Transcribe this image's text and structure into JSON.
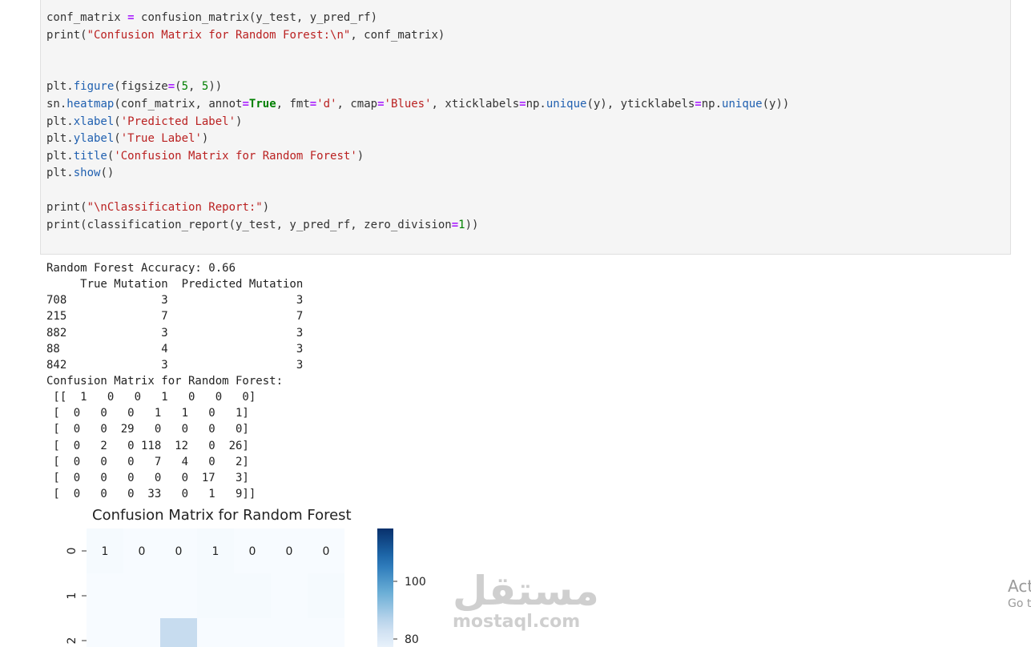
{
  "code": {
    "line1": [
      "conf_matrix ",
      "=",
      " confusion_matrix(y_test, y_pred_rf)"
    ],
    "line2": [
      "print(",
      "\"Confusion Matrix for Random Forest:\\n\"",
      ", conf_matrix)"
    ],
    "line3": [
      "plt.",
      "figure",
      "(figsize",
      "=",
      "(",
      "5",
      ", ",
      "5",
      "))"
    ],
    "line4": [
      "sn.",
      "heatmap",
      "(conf_matrix, annot",
      "=",
      "True",
      ", fmt",
      "=",
      "'d'",
      ", cmap",
      "=",
      "'Blues'",
      ", xticklabels",
      "=",
      "np.",
      "unique",
      "(y), yticklabels",
      "=",
      "np.",
      "unique",
      "(y))"
    ],
    "line5": [
      "plt.",
      "xlabel",
      "(",
      "'Predicted Label'",
      ")"
    ],
    "line6": [
      "plt.",
      "ylabel",
      "(",
      "'True Label'",
      ")"
    ],
    "line7": [
      "plt.",
      "title",
      "(",
      "'Confusion Matrix for Random Forest'",
      ")"
    ],
    "line8": [
      "plt.",
      "show",
      "()"
    ],
    "line9": [
      "print(",
      "\"\\nClassification Report:\"",
      ")"
    ],
    "line10": [
      "print(classification_report(y_test, y_pred_rf, zero_division",
      "=",
      "1",
      "))"
    ]
  },
  "output": {
    "accuracy": "Random Forest Accuracy: 0.66",
    "table_header": "     True Mutation  Predicted Mutation",
    "table_rows": [
      "708              3                   3",
      "215              7                   7",
      "882              3                   3",
      "88               4                   3",
      "842              3                   3"
    ],
    "matrix_heading": "Confusion Matrix for Random Forest:",
    "matrix_rows": [
      " [[  1   0   0   1   0   0   0]",
      " [  0   0   0   1   1   0   1]",
      " [  0   0  29   0   0   0   0]",
      " [  0   2   0 118  12   0  26]",
      " [  0   0   0   7   4   0   2]",
      " [  0   0   0   0   0  17   3]",
      " [  0   0   0  33   0   1   9]]"
    ]
  },
  "chart_data": {
    "type": "heatmap",
    "title": "Confusion Matrix for Random Forest",
    "matrix": [
      [
        1,
        0,
        0,
        1,
        0,
        0,
        0
      ],
      [
        0,
        0,
        0,
        1,
        1,
        0,
        1
      ],
      [
        0,
        0,
        29,
        0,
        0,
        0,
        0
      ]
    ],
    "annotations_row0": [
      "1",
      "0",
      "0",
      "1",
      "0",
      "0",
      "0"
    ],
    "yticklabels": [
      "0",
      "1",
      "2"
    ],
    "colorbar_ticks": [
      "100",
      "80"
    ],
    "vmax": 118,
    "cmap": "Blues"
  },
  "watermark": {
    "arabic": "مستقل",
    "latin": "mostaql.com"
  },
  "activate": {
    "line1": "Act",
    "line2": "Go t"
  }
}
